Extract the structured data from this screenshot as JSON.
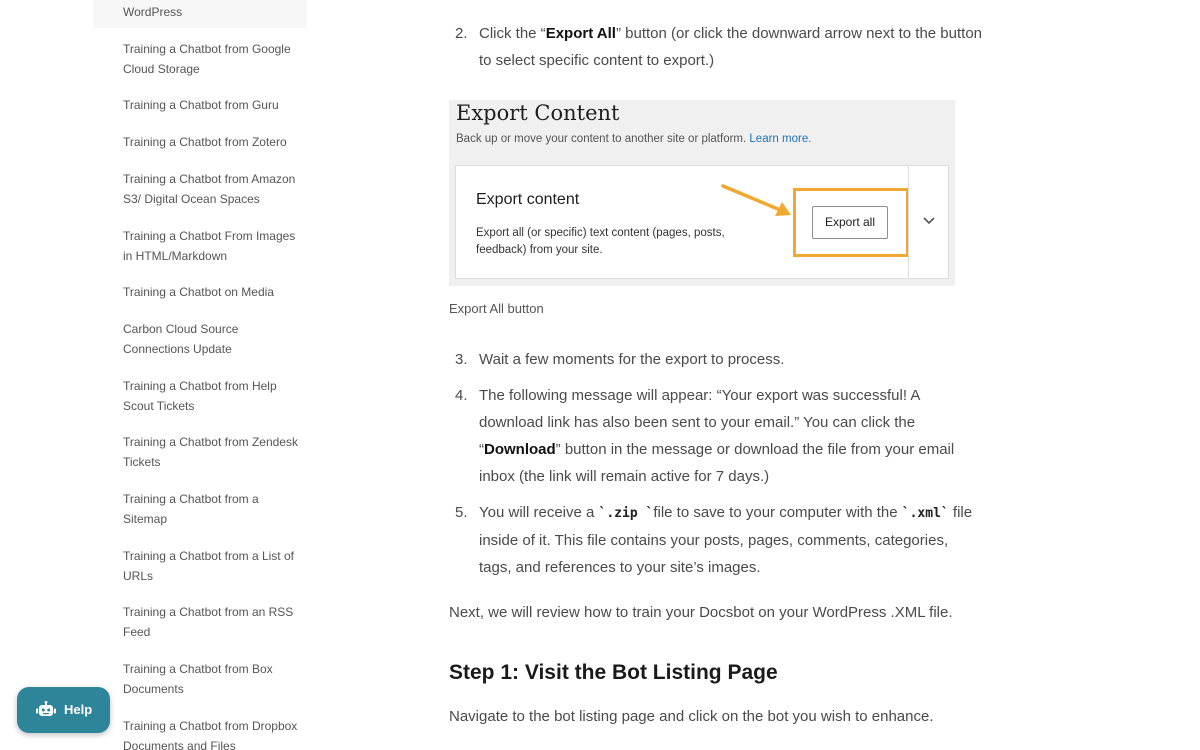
{
  "sidebar": {
    "top_item": "WordPress",
    "items": [
      "Training a Chatbot from Google Cloud Storage",
      "Training a Chatbot from Guru",
      "Training a Chatbot from Zotero",
      "Training a Chatbot from Amazon S3/ Digital Ocean Spaces",
      "Training a Chatbot From Images in HTML/Markdown",
      "Training a Chatbot on Media",
      "Carbon Cloud Source Connections Update",
      "Training a Chatbot from Help Scout Tickets",
      "Training a Chatbot from Zendesk Tickets",
      "Training a Chatbot from a Sitemap",
      "Training a Chatbot from a List of URLs",
      "Training a Chatbot from an RSS Feed",
      "Training a Chatbot from Box Documents",
      "Training a Chatbot from Dropbox Documents and Files"
    ]
  },
  "steps": {
    "s2": {
      "num": "2.",
      "pre": "Click the “",
      "bold": "Export All",
      "post": "” button (or click the downward arrow next to the button to select specific content to export.)"
    },
    "s3": {
      "num": "3.",
      "text": "Wait a few moments for the export to process."
    },
    "s4": {
      "num": "4.",
      "pre": "The following message will appear: “Your export was successful! A download link has also been sent to your email.” You can click the “",
      "bold": "Download",
      "post": "” button in the message or download the file from your email inbox (the link will remain active for 7 days.)"
    },
    "s5": {
      "num": "5.",
      "pre": "You will receive a ",
      "code1": "`.zip `",
      "mid": "file to save to your computer with the ",
      "code2": "`.xml`",
      "post": " file inside of it. This file contains your posts, pages, comments, categories, tags, and references to your site’s images."
    }
  },
  "screenshot": {
    "title": "Export Content",
    "subtitle": "Back up or move your content to another site or platform.",
    "learn_more": "Learn more.",
    "card_title": "Export content",
    "card_desc": "Export all (or specific) text content (pages, posts, feedback) from your site.",
    "button": "Export all",
    "highlight_color": "#f0a830"
  },
  "caption": "Export All button",
  "next_para": "Next, we will review how to train your Docsbot on your WordPress .XML file.",
  "heading": "Step 1: Visit the Bot Listing Page",
  "heading_para": "Navigate to the bot listing page and click on the bot you wish to enhance.",
  "help": {
    "label": "Help",
    "icon": "robot-icon",
    "color": "#2e8599"
  }
}
